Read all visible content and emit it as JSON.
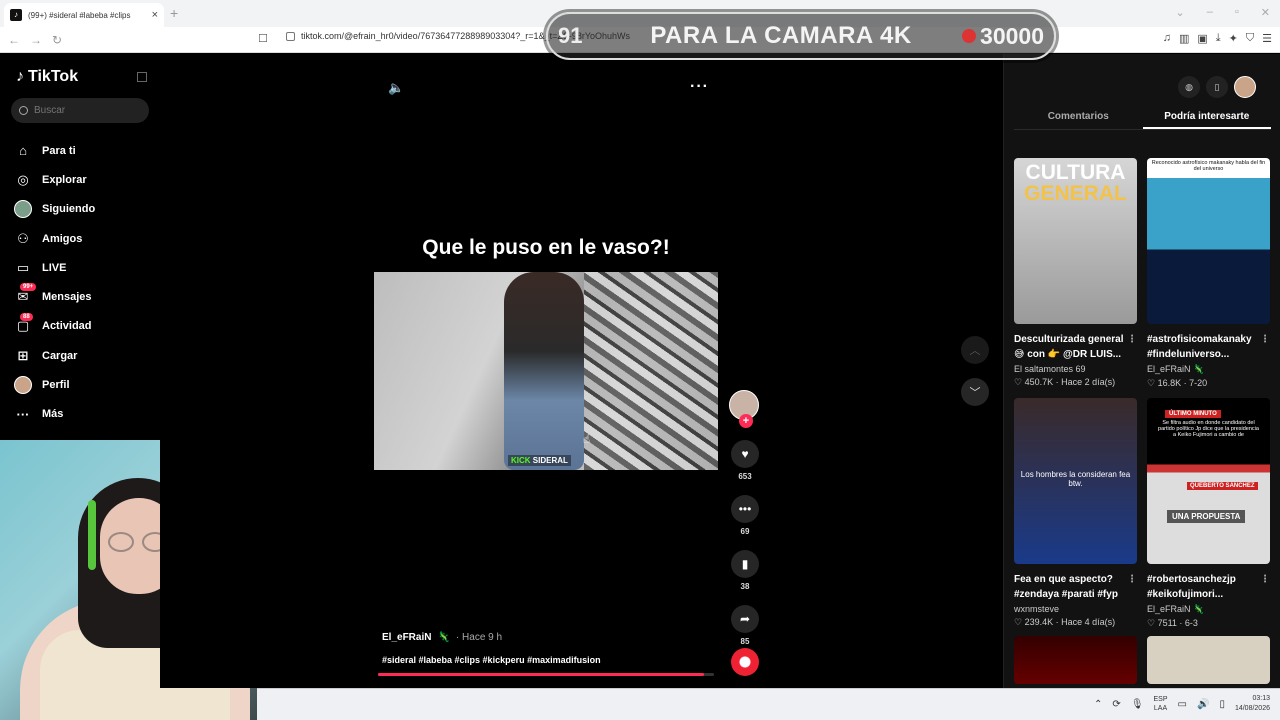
{
  "browser": {
    "tab_title": "(99+) #sideral #labeba #clips",
    "url": "tiktok.com/@efrain_hr0/video/7673647728898903304?_r=1&_t=ZS-98rYoOhuhWs"
  },
  "stream_overlay": {
    "count": "91",
    "text": "PARA LA CAMARA 4K",
    "goal": "30000"
  },
  "sidebar": {
    "logo": "TikTok",
    "search_placeholder": "Buscar",
    "items": [
      {
        "label": "Para ti",
        "icon": "home-icon"
      },
      {
        "label": "Explorar",
        "icon": "compass-icon"
      },
      {
        "label": "Siguiendo",
        "icon": "avatar"
      },
      {
        "label": "Amigos",
        "icon": "users-icon"
      },
      {
        "label": "LIVE",
        "icon": "live-icon"
      },
      {
        "label": "Mensajes",
        "icon": "message-icon",
        "badge": "99+"
      },
      {
        "label": "Actividad",
        "icon": "inbox-icon",
        "badge": "88"
      },
      {
        "label": "Cargar",
        "icon": "plus-square-icon"
      },
      {
        "label": "Perfil",
        "icon": "avatar"
      },
      {
        "label": "Más",
        "icon": "ellipsis-icon"
      }
    ]
  },
  "video": {
    "title": "Que le puso en le vaso?!",
    "watermark_brand": "KICK",
    "watermark_name": "SIDERAL",
    "likes": "653",
    "comments": "69",
    "saves": "38",
    "shares": "85",
    "author": "El_eFRaiN",
    "time": "· Hace 9 h",
    "hashtags": "#sideral #labeba #clips #kickperu #maximadifusion",
    "progress": 0.97
  },
  "right_panel": {
    "tabs": [
      "Comentarios",
      "Podría interesarte"
    ],
    "active_tab": 1,
    "cards": [
      {
        "thumb_text_1": "CULTURA",
        "thumb_text_2": "GENERAL",
        "title": "Desculturizada general 😅 con 👉 @DR LUIS...",
        "author": "El saltamontes 69",
        "stats": "♡ 450.7K · Hace 2 día(s)"
      },
      {
        "thumb_caption": "Reconocido astrofísico makanaky habla del fin del universo",
        "title": "#astrofisicomakanaky #findeluniverso...",
        "author": "El_eFRaiN 🦎",
        "stats": "♡ 16.8K · 7-20"
      },
      {
        "thumb_caption": "Los hombres la consideran fea btw.",
        "title": "Fea en que aspecto? #zendaya #parati #fyp",
        "author": "wxnmsteve",
        "stats": "♡ 239.4K · Hace 4 día(s)"
      },
      {
        "thumb_badge": "ÚLTIMO MINUTO",
        "thumb_caption": "Se filtra audio en donde candidato del partido político Jp dice que la presidencia a Keiko Fujimori a cambio de",
        "thumb_name": "QUEBERTO SANCHEZ",
        "thumb_prop": "UNA PROPUESTA",
        "title": "#robertosanchezjp #keikofujimori...",
        "author": "El_eFRaiN 🦎",
        "stats": "♡ 7511 · 6-3"
      }
    ]
  },
  "taskbar": {
    "lang_1": "ESP",
    "lang_2": "LAA",
    "time": "03:13",
    "date": "14/08/2026"
  }
}
